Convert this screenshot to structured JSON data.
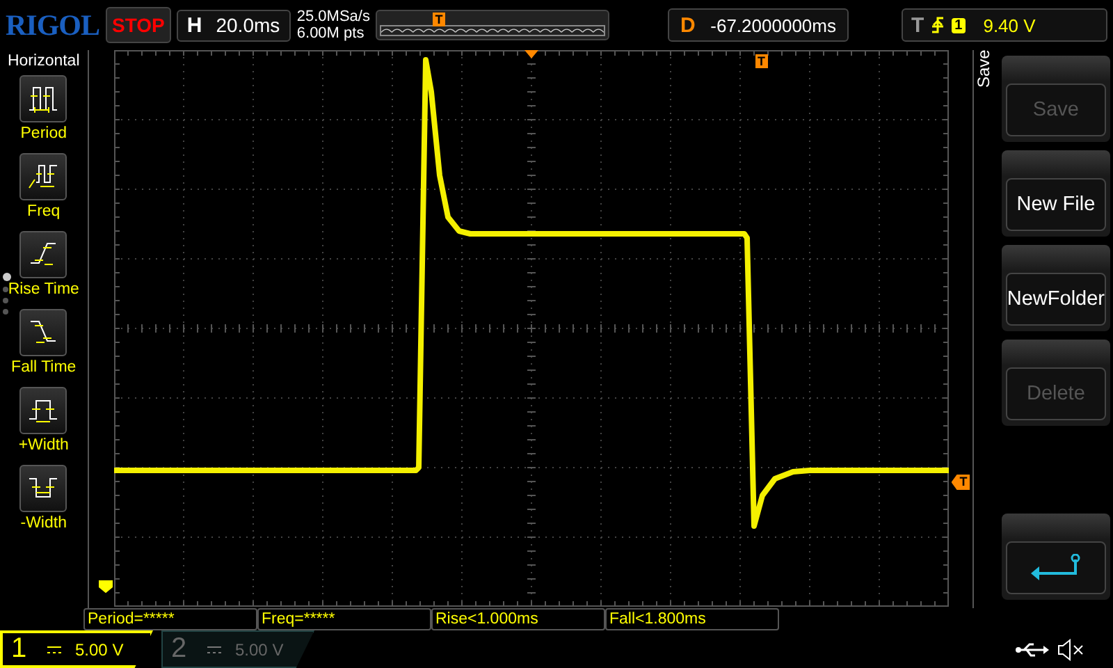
{
  "top_bar": {
    "logo": "RIGOL",
    "run_status": "STOP",
    "horizontal": {
      "label": "H",
      "value": "20.0ms"
    },
    "sample_rate": "25.0MSa/s",
    "memory_depth": "6.00M pts",
    "overview_marker": "T",
    "delay": {
      "label": "D",
      "value": "-67.2000000ms"
    },
    "trigger": {
      "label": "T",
      "source": "1",
      "level": "9.40 V"
    }
  },
  "left_menu": {
    "title": "Horizontal",
    "items": [
      {
        "kind": "period",
        "label": "Period"
      },
      {
        "kind": "freq",
        "label": "Freq"
      },
      {
        "kind": "rise",
        "label": "Rise Time"
      },
      {
        "kind": "fall",
        "label": "Fall Time"
      },
      {
        "kind": "pwidth",
        "label": "+Width"
      },
      {
        "kind": "nwidth",
        "label": "-Width"
      }
    ],
    "pages": [
      {
        "selected": true
      },
      {
        "selected": false
      },
      {
        "selected": false
      },
      {
        "selected": false
      }
    ]
  },
  "screen": {
    "trigger_position_marker": "T",
    "trigger_level_marker": "T"
  },
  "right_menu": {
    "title": "Save",
    "buttons": [
      {
        "kind": "text",
        "label": "Save",
        "disabled": true
      },
      {
        "kind": "text",
        "label": "New File",
        "disabled": false
      },
      {
        "kind": "text",
        "label": "NewFolder",
        "disabled": false
      },
      {
        "kind": "text",
        "label": "Delete",
        "disabled": true
      },
      {
        "kind": "back"
      }
    ]
  },
  "measurements": [
    "Period=*****",
    "Freq=*****",
    "Rise<1.000ms",
    "Fall<1.800ms"
  ],
  "channels": [
    {
      "label": "1",
      "scale": "5.00 V",
      "on": true
    },
    {
      "label": "2",
      "scale": "5.00 V",
      "on": false
    }
  ]
}
